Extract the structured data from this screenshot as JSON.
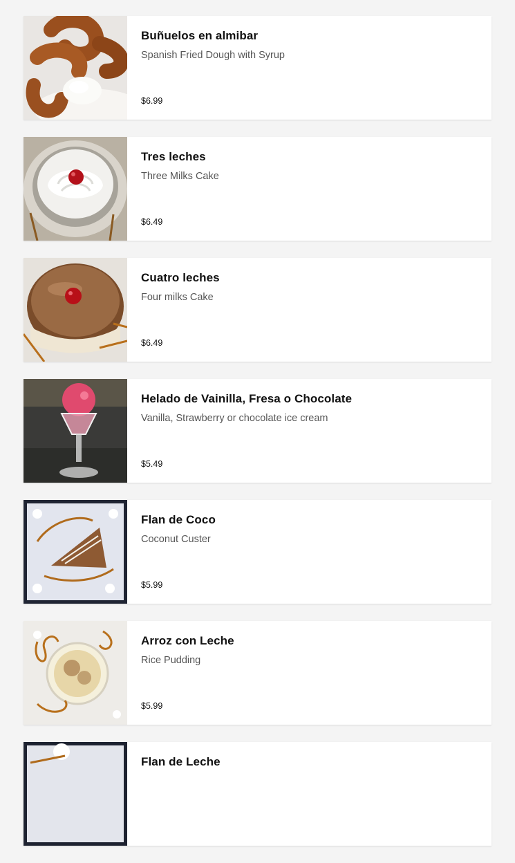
{
  "menu": {
    "items": [
      {
        "name": "Buñuelos en almibar",
        "description": "Spanish Fried Dough with Syrup",
        "price": "$6.99",
        "photo_icon": "fried-dough-photo"
      },
      {
        "name": "Tres leches",
        "description": "Three Milks Cake",
        "price": "$6.49",
        "photo_icon": "whipped-cream-cake-photo"
      },
      {
        "name": "Cuatro leches",
        "description": "Four milks Cake",
        "price": "$6.49",
        "photo_icon": "caramel-cake-photo"
      },
      {
        "name": "Helado de Vainilla, Fresa o Chocolate",
        "description": "Vanilla, Strawberry or chocolate ice cream",
        "price": "$5.49",
        "photo_icon": "ice-cream-sundae-photo"
      },
      {
        "name": "Flan de Coco",
        "description": "Coconut Custer",
        "price": "$5.99",
        "photo_icon": "coconut-flan-photo"
      },
      {
        "name": "Arroz con Leche",
        "description": "Rice Pudding",
        "price": "$5.99",
        "photo_icon": "rice-pudding-photo"
      },
      {
        "name": "Flan de Leche",
        "description": "",
        "price": "",
        "photo_icon": "milk-flan-photo"
      }
    ]
  },
  "colors": {
    "page_background": "#f4f4f4",
    "card_background": "#ffffff",
    "title_text": "#111111",
    "description_text": "#555555"
  }
}
